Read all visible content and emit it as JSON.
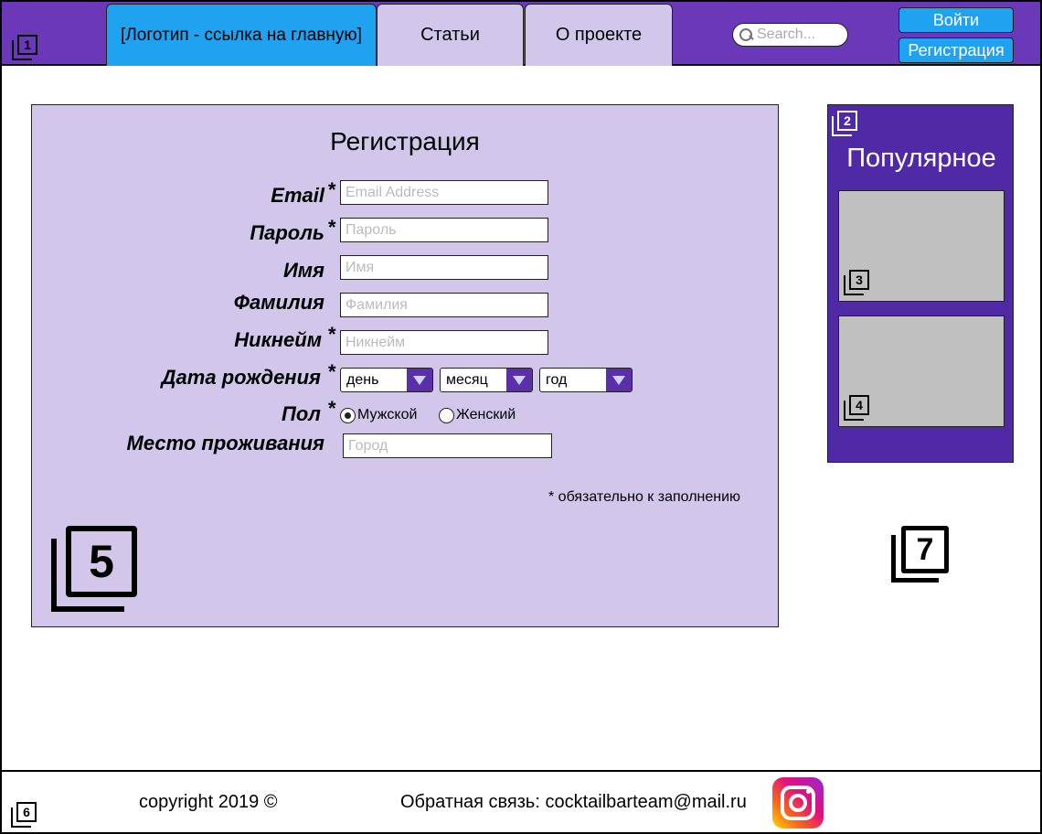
{
  "header": {
    "logo_link": "[Логотип - ссылка на главную]",
    "tabs": [
      "Статьи",
      "О проекте"
    ],
    "search_placeholder": "Search...",
    "login": "Войти",
    "register": "Регистрация",
    "marker": "1"
  },
  "registration": {
    "title": "Регистрация",
    "marker": "5",
    "fields": {
      "email": {
        "label": "Email",
        "placeholder": "Email Address",
        "required": "*"
      },
      "password": {
        "label": "Пароль",
        "placeholder": "Пароль",
        "required": "*"
      },
      "first_name": {
        "label": "Имя",
        "placeholder": "Имя"
      },
      "last_name": {
        "label": "Фамилия",
        "placeholder": "Фамилия"
      },
      "nickname": {
        "label": "Никнейм",
        "placeholder": "Никнейм",
        "required": "*"
      },
      "birthdate": {
        "label": "Дата рождения",
        "required": "*",
        "day": "день",
        "month": "месяц",
        "year": "год"
      },
      "gender": {
        "label": "Пол",
        "required": "*",
        "male": "Мужской",
        "female": "Женский",
        "selected": "Мужской"
      },
      "city": {
        "label": "Место проживания",
        "placeholder": "Город"
      }
    },
    "required_note": "* обязательно к заполнению"
  },
  "popular": {
    "title": "Популярное",
    "marker": "2",
    "cards": [
      {
        "marker": "3"
      },
      {
        "marker": "4"
      }
    ]
  },
  "side_marker": "7",
  "footer": {
    "copyright": "copyright 2019 ©",
    "feedback": "Обратная связь: cocktailbarteam@mail.ru",
    "marker": "6"
  }
}
